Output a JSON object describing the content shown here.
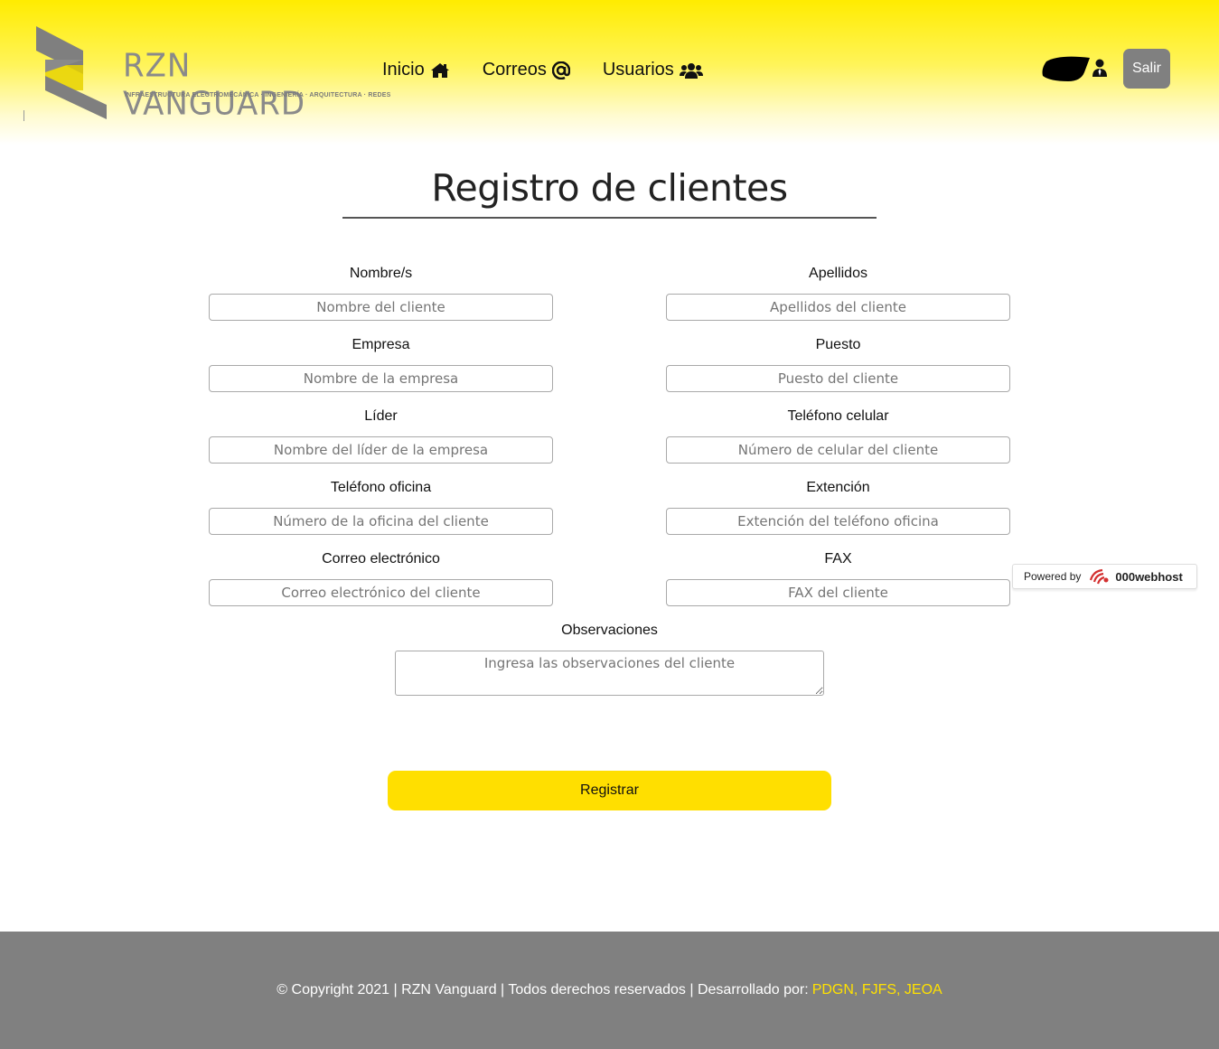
{
  "header": {
    "brand_name": "RZN VANGUARD",
    "brand_tagline": "INFRAESTRUCTURA ELECTROMECÁNICA · INGENIERÍA · ARQUITECTURA · REDES",
    "nav": [
      {
        "label": "Inicio",
        "icon": "home-icon"
      },
      {
        "label": "Correos",
        "icon": "at-icon"
      },
      {
        "label": "Usuarios",
        "icon": "users-icon"
      }
    ],
    "logout_label": "Salir",
    "user_icon": "user-tie-icon"
  },
  "main": {
    "title": "Registro de clientes",
    "fields": {
      "nombre": {
        "label": "Nombre/s",
        "placeholder": "Nombre del cliente"
      },
      "apellidos": {
        "label": "Apellidos",
        "placeholder": "Apellidos del cliente"
      },
      "empresa": {
        "label": "Empresa",
        "placeholder": "Nombre de la empresa"
      },
      "puesto": {
        "label": "Puesto",
        "placeholder": "Puesto del cliente"
      },
      "lider": {
        "label": "Líder",
        "placeholder": "Nombre del líder de la empresa"
      },
      "celular": {
        "label": "Teléfono celular",
        "placeholder": "Número de celular del cliente"
      },
      "oficina": {
        "label": "Teléfono oficina",
        "placeholder": "Número de la oficina del cliente"
      },
      "extension": {
        "label": "Extención",
        "placeholder": "Extención del teléfono oficina"
      },
      "correo": {
        "label": "Correo electrónico",
        "placeholder": "Correo electrónico del cliente"
      },
      "fax": {
        "label": "FAX",
        "placeholder": "FAX del cliente"
      },
      "observaciones": {
        "label": "Observaciones",
        "placeholder": "Ingresa las observaciones del cliente"
      }
    },
    "submit_label": "Registrar"
  },
  "badge": {
    "prefix": "Powered by",
    "host": "000webhost"
  },
  "footer": {
    "text": "© Copyright 2021 | RZN Vanguard | Todos derechos reservados | Desarrollado por:",
    "authors": "PDGN, FJFS, JEOA"
  },
  "colors": {
    "header_yellow": "#ffec00",
    "button_yellow": "#ffdf00",
    "logout_gray": "#808080",
    "footer_gray": "#808080",
    "footer_link": "#ffe100"
  }
}
